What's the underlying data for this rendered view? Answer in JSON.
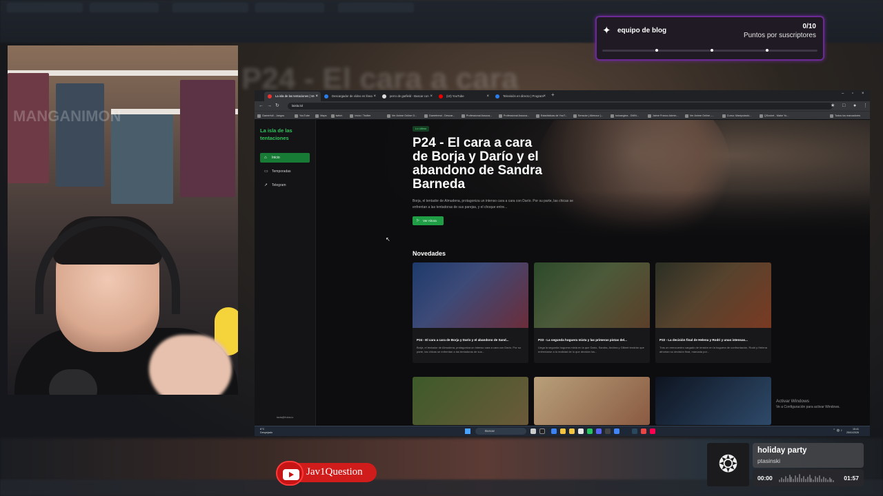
{
  "goal_widget": {
    "icon": "star-badge-icon",
    "title": "equipo de blog",
    "count": "0/10",
    "subtitle": "Puntos por suscriptores",
    "progress": 0
  },
  "browser": {
    "tabs": [
      {
        "label": "La isla de las tentaciones | Ve",
        "active": true,
        "color": "#e33"
      },
      {
        "label": "Descargador de vídeo en línea",
        "active": false,
        "color": "#2b7de9"
      },
      {
        "label": "perro de garfield - Buscar con",
        "active": false,
        "color": "#ddd"
      },
      {
        "label": "(10) YouTube",
        "active": false,
        "color": "#e00"
      },
      {
        "label": "Televisión en directo | Program",
        "active": false,
        "color": "#2b7de9"
      }
    ],
    "url": "laisla.lol",
    "bookmarks": [
      "Gamerfull - Juegos",
      "YouTube",
      "Maps",
      "twitch",
      "Inicio / Twitter",
      "Ver Anime Online G...",
      "Gametrend - Descar...",
      "Professional Assoca...",
      "Professional Assoca...",
      "Estadísticas de YouT...",
      "Sensdor | Alienour |...",
      "holoanglea - DWN...",
      "Jaime Franco Admin...",
      "Ver Anime Online -...",
      "Curso: Manipulació...",
      "QSocket - Make Yo..."
    ],
    "all_bookmarks": "Todos los marcadores"
  },
  "site": {
    "brand": "La isla de las tentaciones",
    "nav": [
      {
        "label": "Inicio",
        "icon": "home-icon",
        "active": true
      },
      {
        "label": "Temporadas",
        "icon": "tv-icon",
        "active": false
      },
      {
        "label": "Telegram",
        "icon": "send-icon",
        "active": false
      }
    ],
    "footer": "tacta@frutos.io",
    "hero": {
      "badge": "Lo último",
      "title": "P24 - El cara a cara de Borja y Darío y el abandono de Sandra Barneda",
      "description": "Borja, el tentador de Almudena, protagoniza un intenso cara a cara con Darío. Por su parte, las chicas se enfrentan a las tentadoras de sus parejas, y el choque entre...",
      "button": "Ver Ahora"
    },
    "section_title": "Novedades",
    "cards": [
      {
        "title": "P24 - El cara a cara de Borja y Darío y el abandono de Sand...",
        "desc": "Borja, el tentador de Almudena, protagoniza un intenso cara a cara con Darío. Por su parte, las chicas se enfrentan a las tentadoras de sus...",
        "colors": [
          "#1d3a6b",
          "#6b2d3a"
        ]
      },
      {
        "title": "P23 - La segunda hoguera mixta y las primeras pistas del...",
        "desc": "Llega la segunda hoguera mixta en la que Darío, Sandra, Andrea y Gilbert tendrán que enfrentarse a la realidad de lo que decidan los...",
        "colors": [
          "#2c4a2a",
          "#5b3f2a"
        ]
      },
      {
        "title": "P22 - La decisión final de Helena y Rodri y unas intensas...",
        "desc": "Tras un reencuentro cargado de tensión en la hoguera de confrontación, Rodri y Helena afrontan su decisión final, marcada por...",
        "colors": [
          "#2b2f24",
          "#7a3a22"
        ]
      }
    ]
  },
  "taskbar": {
    "weather_temp": "6°C",
    "weather_desc": "Despejado",
    "search": "Buscar",
    "time": "15:41",
    "date": "25/01/2026",
    "activate_title": "Activar Windows",
    "activate_sub": "Ve a Configuración para activar Windows."
  },
  "social": {
    "platform_icon": "youtube-icon",
    "name": "Jav1Question"
  },
  "music": {
    "art_icon": "ornament-emblem-icon",
    "song": "holiday party",
    "artist": "ptasinski",
    "elapsed": "00:00",
    "total": "01:57"
  },
  "webcam": {
    "watermark": "MANGANIMON"
  }
}
